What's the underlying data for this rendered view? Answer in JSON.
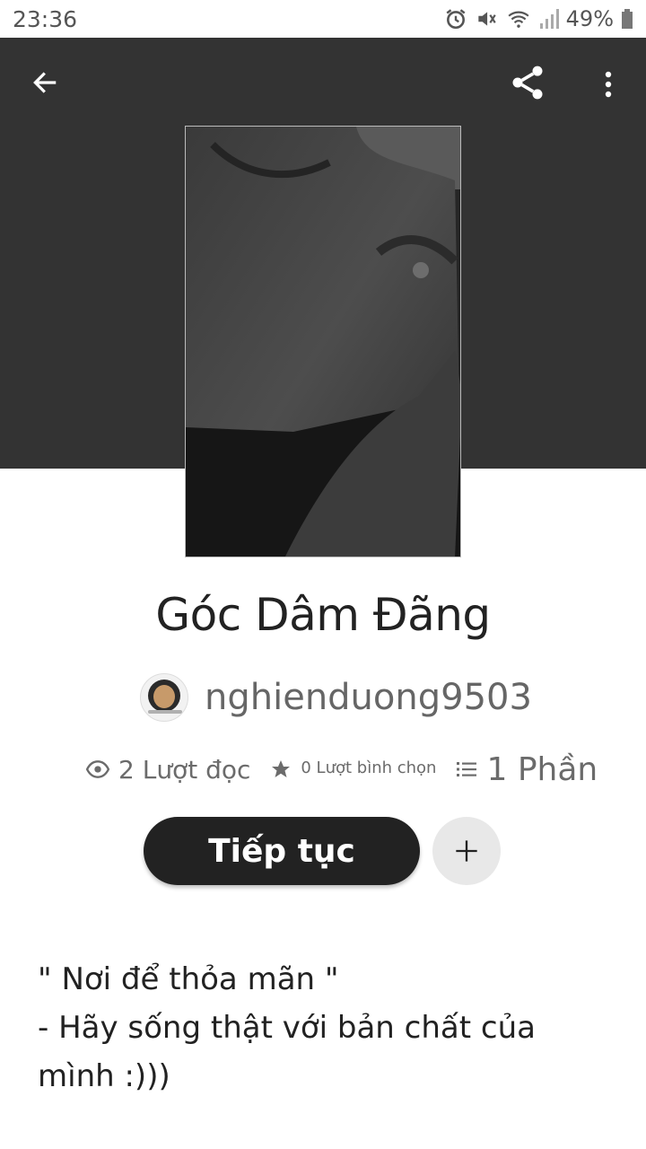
{
  "status_bar": {
    "time": "23:36",
    "battery": "49%"
  },
  "toolbar": {
    "back_icon": "arrow-left-icon",
    "share_icon": "share-icon",
    "more_icon": "more-vertical-icon"
  },
  "story": {
    "title": "Góc Dâm Đãng",
    "author": "nghienduong9503",
    "reads": "2 Lượt đọc",
    "votes": "0 Lượt bình chọn",
    "parts": "1 Phần"
  },
  "actions": {
    "continue_label": "Tiếp tục",
    "add_icon": "plus-icon"
  },
  "description": {
    "line1": "\" Nơi để thỏa mãn \"",
    "line2": "",
    "line3": "- Hãy sống thật với bản chất của",
    "line4": "mình :)))"
  },
  "colors": {
    "header_bg": "#333333",
    "button_bg": "#222222",
    "add_bg": "#e8e8e8"
  }
}
